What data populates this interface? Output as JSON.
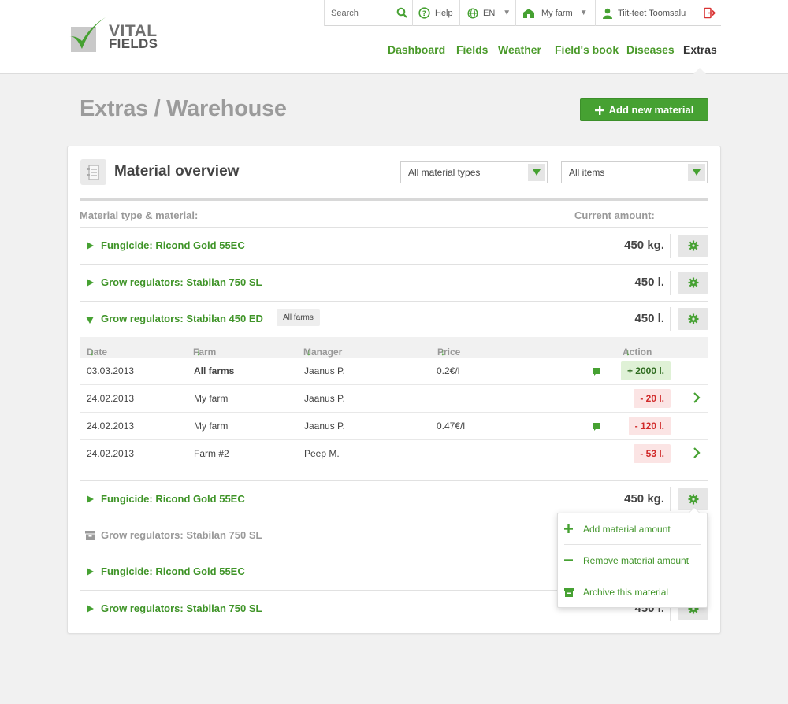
{
  "brand": {
    "line1": "VITAL",
    "line2": "FIELDS"
  },
  "topbar": {
    "search_placeholder": "Search",
    "help": "Help",
    "language": "EN",
    "farm": "My farm",
    "user": "Tiit-teet Toomsalu"
  },
  "nav": [
    "Dashboard",
    "Fields",
    "Weather",
    "Field's book",
    "Diseases",
    "Extras"
  ],
  "page": {
    "title": "Extras / Warehouse",
    "add_button": "Add new material"
  },
  "card": {
    "title": "Material overview",
    "filter_type": "All material types",
    "filter_items": "All items",
    "col_material": "Material type & material:",
    "col_amount": "Current amount:"
  },
  "materials": [
    {
      "name": "Fungicide: Ricond Gold 55EC",
      "amount": "450 kg."
    },
    {
      "name": "Grow regulators: Stabilan 750 SL",
      "amount": "450 l."
    },
    {
      "name": "Grow regulators: Stabilan 450 ED",
      "amount": "450 l.",
      "tag": "All farms"
    },
    {
      "name": "Fungicide: Ricond Gold 55EC",
      "amount": "450 kg."
    },
    {
      "name": "Grow regulators: Stabilan 750 SL",
      "amount": ""
    },
    {
      "name": "Fungicide: Ricond Gold 55EC",
      "amount": ""
    },
    {
      "name": "Grow regulators: Stabilan 750 SL",
      "amount": "450 l."
    }
  ],
  "detail": {
    "headers": {
      "date": "Date",
      "farm": "Farm",
      "manager": "Manager",
      "price": "Price",
      "action": "Action"
    },
    "rows": [
      {
        "date": "03.03.2013",
        "farm": "All farms",
        "manager": "Jaanus P.",
        "price": "0.2€/l",
        "action": "+ 2000 l."
      },
      {
        "date": "24.02.2013",
        "farm": "My farm",
        "manager": "Jaanus P.",
        "price": "",
        "action": "- 20 l."
      },
      {
        "date": "24.02.2013",
        "farm": "My farm",
        "manager": "Jaanus P.",
        "price": "0.47€/l",
        "action": "- 120 l."
      },
      {
        "date": "24.02.2013",
        "farm": "Farm #2",
        "manager": "Peep M.",
        "price": "",
        "action": "- 53 l."
      }
    ]
  },
  "menu": [
    "Add material amount",
    "Remove material amount",
    "Archive this material"
  ],
  "colors": {
    "accent": "#46a132",
    "negative": "#d12a2a",
    "title_gray": "#9b9b9b"
  }
}
